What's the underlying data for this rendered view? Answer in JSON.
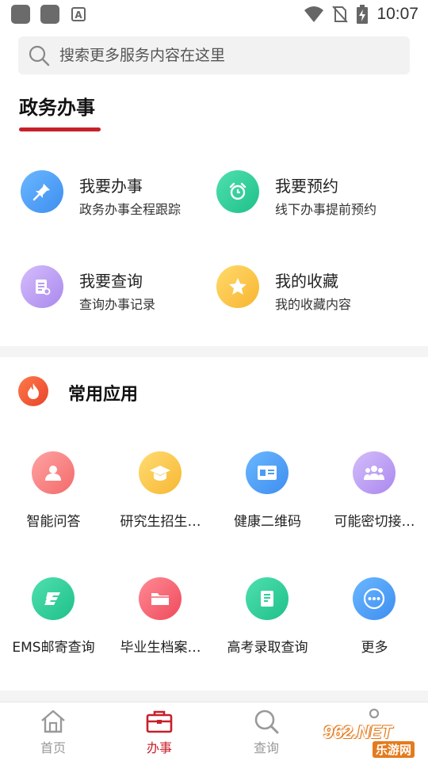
{
  "status_bar": {
    "time": "10:07"
  },
  "search": {
    "placeholder": "搜索更多服务内容在这里"
  },
  "gov_section": {
    "title": "政务办事",
    "items": [
      {
        "title": "我要办事",
        "subtitle": "政务办事全程跟踪",
        "icon": "pin-icon",
        "color": "#4a9cf5"
      },
      {
        "title": "我要预约",
        "subtitle": "线下办事提前预约",
        "icon": "alarm-clock-icon",
        "color": "#2fcf9a"
      },
      {
        "title": "我要查询",
        "subtitle": "查询办事记录",
        "icon": "document-search-icon",
        "color": "#b99af0"
      },
      {
        "title": "我的收藏",
        "subtitle": "我的收藏内容",
        "icon": "star-icon",
        "color": "#fcc944"
      }
    ]
  },
  "apps_section": {
    "title": "常用应用",
    "items": [
      {
        "label": "智能问答",
        "icon": "person-icon",
        "color": "#f77f7f"
      },
      {
        "label": "研究生招生…",
        "icon": "graduation-cap-icon",
        "color": "#fcc944"
      },
      {
        "label": "健康二维码",
        "icon": "id-card-icon",
        "color": "#4a9cf5"
      },
      {
        "label": "可能密切接…",
        "icon": "group-icon",
        "color": "#b99af0"
      },
      {
        "label": "EMS邮寄查询",
        "icon": "ems-icon",
        "color": "#2fcf9a"
      },
      {
        "label": "毕业生档案…",
        "icon": "folder-icon",
        "color": "#f5606e"
      },
      {
        "label": "高考录取查询",
        "icon": "document-icon",
        "color": "#2fcf9a"
      },
      {
        "label": "更多",
        "icon": "more-dots-icon",
        "color": "#4a9cf5"
      }
    ]
  },
  "bottom_nav": {
    "items": [
      {
        "label": "首页",
        "icon": "home-icon"
      },
      {
        "label": "办事",
        "icon": "briefcase-icon",
        "active": true
      },
      {
        "label": "查询",
        "icon": "search-icon"
      }
    ]
  },
  "watermark": {
    "top": "962.NET",
    "bottom": "乐游网"
  }
}
